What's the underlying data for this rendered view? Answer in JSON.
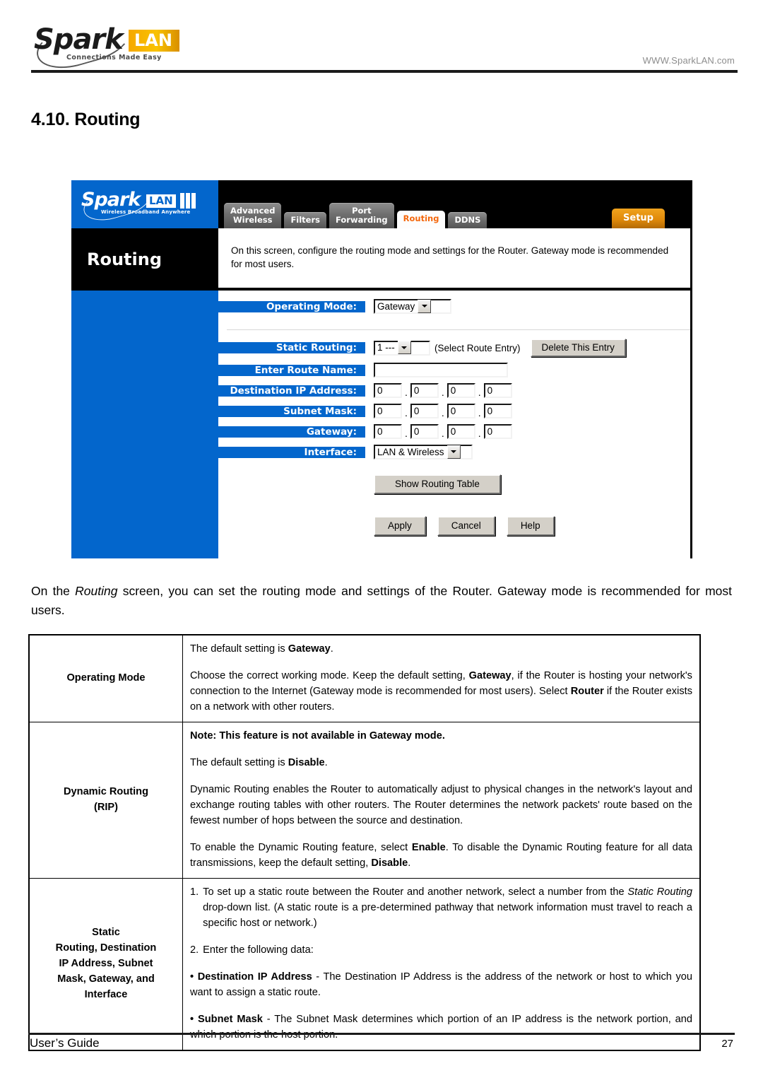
{
  "header": {
    "logo_word": "Spark",
    "logo_badge": "LAN",
    "logo_tagline": "Connections Made Easy",
    "site_url": "WWW.SparkLAN.com"
  },
  "section": {
    "title": "4.10. Routing"
  },
  "router_ui": {
    "logo_word": "Spark",
    "logo_badge": "LAN",
    "logo_tagline": "Wireless Broadband Anywhere",
    "tabs": [
      {
        "label": "Advanced\nWireless",
        "active": false
      },
      {
        "label": "Filters",
        "active": false
      },
      {
        "label": "Port\nForwarding",
        "active": false
      },
      {
        "label": "Routing",
        "active": true
      },
      {
        "label": "DDNS",
        "active": false
      }
    ],
    "setup_button": "Setup",
    "page_title": "Routing",
    "description": "On this screen, configure the routing mode and settings for the Router. Gateway mode is recommended for most users.",
    "fields": {
      "operating_mode_label": "Operating Mode:",
      "operating_mode_value": "Gateway",
      "static_routing_label": "Static Routing:",
      "static_routing_value": "1 ---",
      "static_routing_hint": "(Select Route Entry)",
      "delete_entry_button": "Delete This Entry",
      "route_name_label": "Enter Route Name:",
      "route_name_value": "",
      "destination_ip_label": "Destination IP Address:",
      "destination_ip": [
        "0",
        "0",
        "0",
        "0"
      ],
      "subnet_mask_label": "Subnet Mask:",
      "subnet_mask": [
        "0",
        "0",
        "0",
        "0"
      ],
      "gateway_label": "Gateway:",
      "gateway": [
        "0",
        "0",
        "0",
        "0"
      ],
      "interface_label": "Interface:",
      "interface_value": "LAN & Wireless"
    },
    "buttons": {
      "show_routing_table": "Show Routing Table",
      "apply": "Apply",
      "cancel": "Cancel",
      "help": "Help"
    },
    "colors": {
      "blue": "#0366cc",
      "orange": "#f4670c",
      "setup_orange": "#e08a0b",
      "black": "#000000"
    }
  },
  "lead_paragraph": {
    "part1": "On the ",
    "emphasis": "Routing",
    "part2": " screen, you can set the routing mode and settings of the Router. Gateway mode is recommended for most users."
  },
  "table": {
    "rows": [
      {
        "term": "Operating Mode",
        "paragraphs": [
          {
            "segments": [
              {
                "text": "The default setting is ",
                "bold": false
              },
              {
                "text": "Gateway",
                "bold": true
              },
              {
                "text": ".",
                "bold": false
              }
            ]
          },
          {
            "segments": [
              {
                "text": "Choose the correct working mode. Keep the default setting, ",
                "bold": false
              },
              {
                "text": "Gateway",
                "bold": true
              },
              {
                "text": ", if the Router is hosting your network's connection to the Internet (Gateway mode is recommended for most users). Select ",
                "bold": false
              },
              {
                "text": "Router",
                "bold": true
              },
              {
                "text": " if the Router exists on a network with other routers.",
                "bold": false
              }
            ]
          }
        ]
      },
      {
        "term": "Dynamic Routing\n(RIP)",
        "paragraphs": [
          {
            "segments": [
              {
                "text": "Note: This feature is not available in Gateway mode.",
                "bold": true
              }
            ]
          },
          {
            "segments": [
              {
                "text": "The default setting is ",
                "bold": false
              },
              {
                "text": "Disable",
                "bold": true
              },
              {
                "text": ".",
                "bold": false
              }
            ]
          },
          {
            "segments": [
              {
                "text": "Dynamic Routing enables the Router to automatically adjust to physical changes in the network's layout and exchange routing tables with other routers. The Router determines the network packets' route based on the fewest number of hops between the source and destination.",
                "bold": false
              }
            ]
          },
          {
            "segments": [
              {
                "text": "To enable the Dynamic Routing feature, select ",
                "bold": false
              },
              {
                "text": "Enable",
                "bold": true
              },
              {
                "text": ". To disable the Dynamic Routing feature for all data transmissions, keep the default setting, ",
                "bold": false
              },
              {
                "text": "Disable",
                "bold": true
              },
              {
                "text": ".",
                "bold": false
              }
            ]
          }
        ]
      },
      {
        "term": "Static\nRouting,  Destination\nIP Address, Subnet\nMask, Gateway, and\nInterface",
        "numbered": [
          {
            "n": "1.",
            "segments": [
              {
                "text": "To set up a static route between the Router and another network, select a number from the ",
                "bold": false,
                "italic": false
              },
              {
                "text": "Static Routing",
                "bold": false,
                "italic": true
              },
              {
                "text": " drop-down list. (A static route is a pre-determined pathway that network information must travel to reach a specific host or network.)",
                "bold": false,
                "italic": false
              }
            ]
          },
          {
            "n": "2.",
            "segments": [
              {
                "text": "Enter the following data:",
                "bold": false,
                "italic": false
              }
            ]
          }
        ],
        "bullets": [
          {
            "segments": [
              {
                "text": "• ",
                "bold": true
              },
              {
                "text": "Destination IP Address",
                "bold": true
              },
              {
                "text": "  - The Destination IP Address is the address of the network or host to which you want to assign a static route.",
                "bold": false
              }
            ]
          },
          {
            "segments": [
              {
                "text": "• ",
                "bold": true
              },
              {
                "text": "Subnet Mask",
                "bold": true
              },
              {
                "text": "  - The Subnet Mask determines which portion of an IP address is the network portion, and which portion is the host portion.",
                "bold": false
              }
            ]
          }
        ]
      }
    ]
  },
  "footer": {
    "left": "User’s Guide",
    "page_number": "27"
  }
}
